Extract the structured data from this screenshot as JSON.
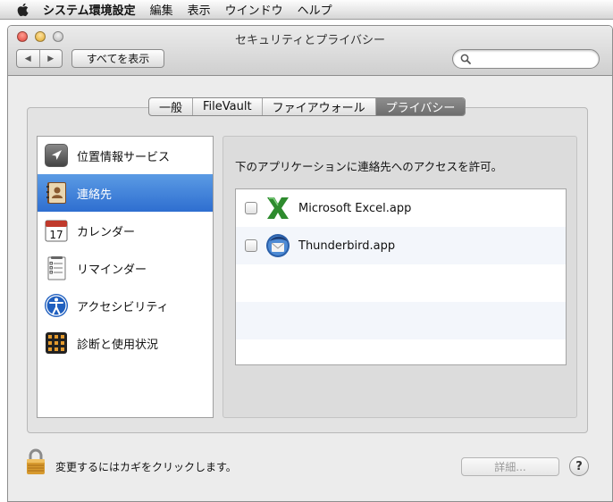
{
  "menubar": {
    "apple_icon": "apple-icon",
    "app_name": "システム環境設定",
    "items": [
      "編集",
      "表示",
      "ウインドウ",
      "ヘルプ"
    ]
  },
  "window": {
    "title": "セキュリティとプライバシー",
    "back_glyph": "◀",
    "forward_glyph": "▶",
    "show_all_label": "すべてを表示",
    "search_placeholder": ""
  },
  "tabs": [
    {
      "label": "一般",
      "active": false
    },
    {
      "label": "FileVault",
      "active": false
    },
    {
      "label": "ファイアウォール",
      "active": false
    },
    {
      "label": "プライバシー",
      "active": true
    }
  ],
  "sidebar": {
    "selected": "連絡先",
    "items": [
      {
        "label": "位置情報サービス",
        "icon": "location-arrow-icon"
      },
      {
        "label": "連絡先",
        "icon": "address-book-icon"
      },
      {
        "label": "カレンダー",
        "icon": "calendar-icon",
        "icon_text": "17"
      },
      {
        "label": "リマインダー",
        "icon": "reminders-icon"
      },
      {
        "label": "アクセシビリティ",
        "icon": "accessibility-icon"
      },
      {
        "label": "診断と使用状況",
        "icon": "diagnostics-icon"
      }
    ]
  },
  "right_pane": {
    "label": "下のアプリケーションに連絡先へのアクセスを許可。",
    "apps": [
      {
        "name": "Microsoft Excel.app",
        "icon": "excel-icon",
        "checked": false
      },
      {
        "name": "Thunderbird.app",
        "icon": "thunderbird-icon",
        "checked": false
      }
    ]
  },
  "footer": {
    "lock_text": "変更するにはカギをクリックします。",
    "details_label": "詳細...",
    "help_label": "?"
  },
  "colors": {
    "selection": "#3a7bd5",
    "tab_active": "#7a7a7a",
    "window_bg": "#ececec"
  }
}
